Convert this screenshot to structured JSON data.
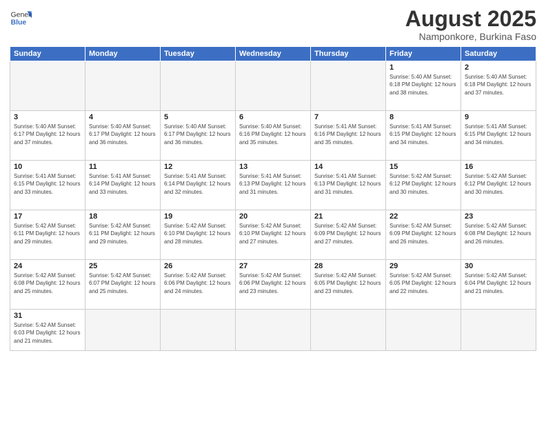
{
  "header": {
    "logo_general": "General",
    "logo_blue": "Blue",
    "month_year": "August 2025",
    "location": "Namponkore, Burkina Faso"
  },
  "weekdays": [
    "Sunday",
    "Monday",
    "Tuesday",
    "Wednesday",
    "Thursday",
    "Friday",
    "Saturday"
  ],
  "weeks": [
    [
      {
        "day": "",
        "info": ""
      },
      {
        "day": "",
        "info": ""
      },
      {
        "day": "",
        "info": ""
      },
      {
        "day": "",
        "info": ""
      },
      {
        "day": "",
        "info": ""
      },
      {
        "day": "1",
        "info": "Sunrise: 5:40 AM\nSunset: 6:18 PM\nDaylight: 12 hours\nand 38 minutes."
      },
      {
        "day": "2",
        "info": "Sunrise: 5:40 AM\nSunset: 6:18 PM\nDaylight: 12 hours\nand 37 minutes."
      }
    ],
    [
      {
        "day": "3",
        "info": "Sunrise: 5:40 AM\nSunset: 6:17 PM\nDaylight: 12 hours\nand 37 minutes."
      },
      {
        "day": "4",
        "info": "Sunrise: 5:40 AM\nSunset: 6:17 PM\nDaylight: 12 hours\nand 36 minutes."
      },
      {
        "day": "5",
        "info": "Sunrise: 5:40 AM\nSunset: 6:17 PM\nDaylight: 12 hours\nand 36 minutes."
      },
      {
        "day": "6",
        "info": "Sunrise: 5:40 AM\nSunset: 6:16 PM\nDaylight: 12 hours\nand 35 minutes."
      },
      {
        "day": "7",
        "info": "Sunrise: 5:41 AM\nSunset: 6:16 PM\nDaylight: 12 hours\nand 35 minutes."
      },
      {
        "day": "8",
        "info": "Sunrise: 5:41 AM\nSunset: 6:15 PM\nDaylight: 12 hours\nand 34 minutes."
      },
      {
        "day": "9",
        "info": "Sunrise: 5:41 AM\nSunset: 6:15 PM\nDaylight: 12 hours\nand 34 minutes."
      }
    ],
    [
      {
        "day": "10",
        "info": "Sunrise: 5:41 AM\nSunset: 6:15 PM\nDaylight: 12 hours\nand 33 minutes."
      },
      {
        "day": "11",
        "info": "Sunrise: 5:41 AM\nSunset: 6:14 PM\nDaylight: 12 hours\nand 33 minutes."
      },
      {
        "day": "12",
        "info": "Sunrise: 5:41 AM\nSunset: 6:14 PM\nDaylight: 12 hours\nand 32 minutes."
      },
      {
        "day": "13",
        "info": "Sunrise: 5:41 AM\nSunset: 6:13 PM\nDaylight: 12 hours\nand 31 minutes."
      },
      {
        "day": "14",
        "info": "Sunrise: 5:41 AM\nSunset: 6:13 PM\nDaylight: 12 hours\nand 31 minutes."
      },
      {
        "day": "15",
        "info": "Sunrise: 5:42 AM\nSunset: 6:12 PM\nDaylight: 12 hours\nand 30 minutes."
      },
      {
        "day": "16",
        "info": "Sunrise: 5:42 AM\nSunset: 6:12 PM\nDaylight: 12 hours\nand 30 minutes."
      }
    ],
    [
      {
        "day": "17",
        "info": "Sunrise: 5:42 AM\nSunset: 6:11 PM\nDaylight: 12 hours\nand 29 minutes."
      },
      {
        "day": "18",
        "info": "Sunrise: 5:42 AM\nSunset: 6:11 PM\nDaylight: 12 hours\nand 29 minutes."
      },
      {
        "day": "19",
        "info": "Sunrise: 5:42 AM\nSunset: 6:10 PM\nDaylight: 12 hours\nand 28 minutes."
      },
      {
        "day": "20",
        "info": "Sunrise: 5:42 AM\nSunset: 6:10 PM\nDaylight: 12 hours\nand 27 minutes."
      },
      {
        "day": "21",
        "info": "Sunrise: 5:42 AM\nSunset: 6:09 PM\nDaylight: 12 hours\nand 27 minutes."
      },
      {
        "day": "22",
        "info": "Sunrise: 5:42 AM\nSunset: 6:09 PM\nDaylight: 12 hours\nand 26 minutes."
      },
      {
        "day": "23",
        "info": "Sunrise: 5:42 AM\nSunset: 6:08 PM\nDaylight: 12 hours\nand 26 minutes."
      }
    ],
    [
      {
        "day": "24",
        "info": "Sunrise: 5:42 AM\nSunset: 6:08 PM\nDaylight: 12 hours\nand 25 minutes."
      },
      {
        "day": "25",
        "info": "Sunrise: 5:42 AM\nSunset: 6:07 PM\nDaylight: 12 hours\nand 25 minutes."
      },
      {
        "day": "26",
        "info": "Sunrise: 5:42 AM\nSunset: 6:06 PM\nDaylight: 12 hours\nand 24 minutes."
      },
      {
        "day": "27",
        "info": "Sunrise: 5:42 AM\nSunset: 6:06 PM\nDaylight: 12 hours\nand 23 minutes."
      },
      {
        "day": "28",
        "info": "Sunrise: 5:42 AM\nSunset: 6:05 PM\nDaylight: 12 hours\nand 23 minutes."
      },
      {
        "day": "29",
        "info": "Sunrise: 5:42 AM\nSunset: 6:05 PM\nDaylight: 12 hours\nand 22 minutes."
      },
      {
        "day": "30",
        "info": "Sunrise: 5:42 AM\nSunset: 6:04 PM\nDaylight: 12 hours\nand 21 minutes."
      }
    ],
    [
      {
        "day": "31",
        "info": "Sunrise: 5:42 AM\nSunset: 6:03 PM\nDaylight: 12 hours\nand 21 minutes."
      },
      {
        "day": "",
        "info": ""
      },
      {
        "day": "",
        "info": ""
      },
      {
        "day": "",
        "info": ""
      },
      {
        "day": "",
        "info": ""
      },
      {
        "day": "",
        "info": ""
      },
      {
        "day": "",
        "info": ""
      }
    ]
  ]
}
